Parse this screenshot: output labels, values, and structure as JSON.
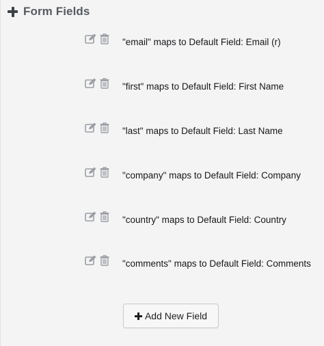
{
  "section": {
    "title": "Form Fields",
    "icon": "plus-icon"
  },
  "fields": [
    {
      "text": "\"email\" maps to Default Field: Email (r)"
    },
    {
      "text": "\"first\" maps to Default Field: First Name"
    },
    {
      "text": "\"last\" maps to Default Field: Last Name"
    },
    {
      "text": "\"company\" maps to Default Field: Company"
    },
    {
      "text": "\"country\" maps to Default Field: Country"
    },
    {
      "text": "\"comments\" maps to Default Field: Comments"
    }
  ],
  "row_icons": {
    "edit": "edit-icon",
    "delete": "trash-icon"
  },
  "add_button": {
    "label": "Add New Field",
    "icon": "plus-icon"
  },
  "colors": {
    "background": "#f4f4f4",
    "icon_gray": "#9a9ea4",
    "header_text": "#555a60"
  }
}
